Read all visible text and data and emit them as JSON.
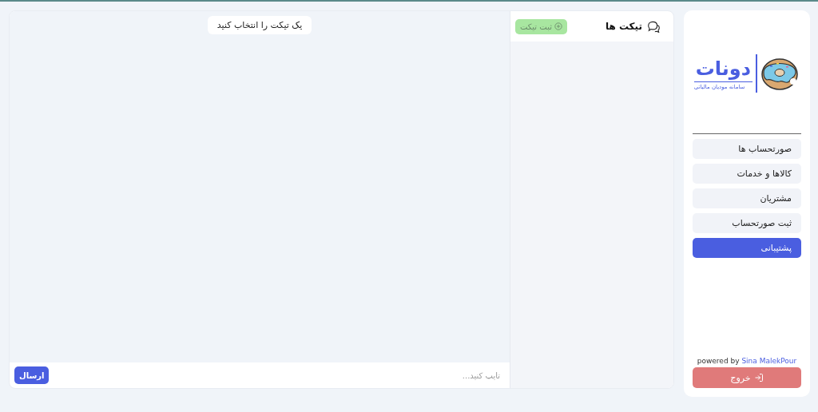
{
  "brand": {
    "name": "دونات",
    "subtitle": "سامانه مودیان مالیاتی"
  },
  "nav": [
    {
      "label": "صورتحساب ها",
      "selected": false
    },
    {
      "label": "کالاها و خدمات",
      "selected": false
    },
    {
      "label": "مشتریان",
      "selected": false
    },
    {
      "label": "ثبت صورتحساب",
      "selected": false
    },
    {
      "label": "پشتیبانی",
      "selected": true
    }
  ],
  "credit": {
    "text": "powered by",
    "link": "Sina MalekPour"
  },
  "logout": {
    "label": "خروج"
  },
  "tickets": {
    "title": "تیکت ها",
    "add_button": "ثبت تیکت"
  },
  "chat": {
    "hint": "یک تیکت را انتخاب کنید",
    "input": {
      "placeholder": "تایپ کنید..."
    },
    "send_button": "ارسال"
  }
}
